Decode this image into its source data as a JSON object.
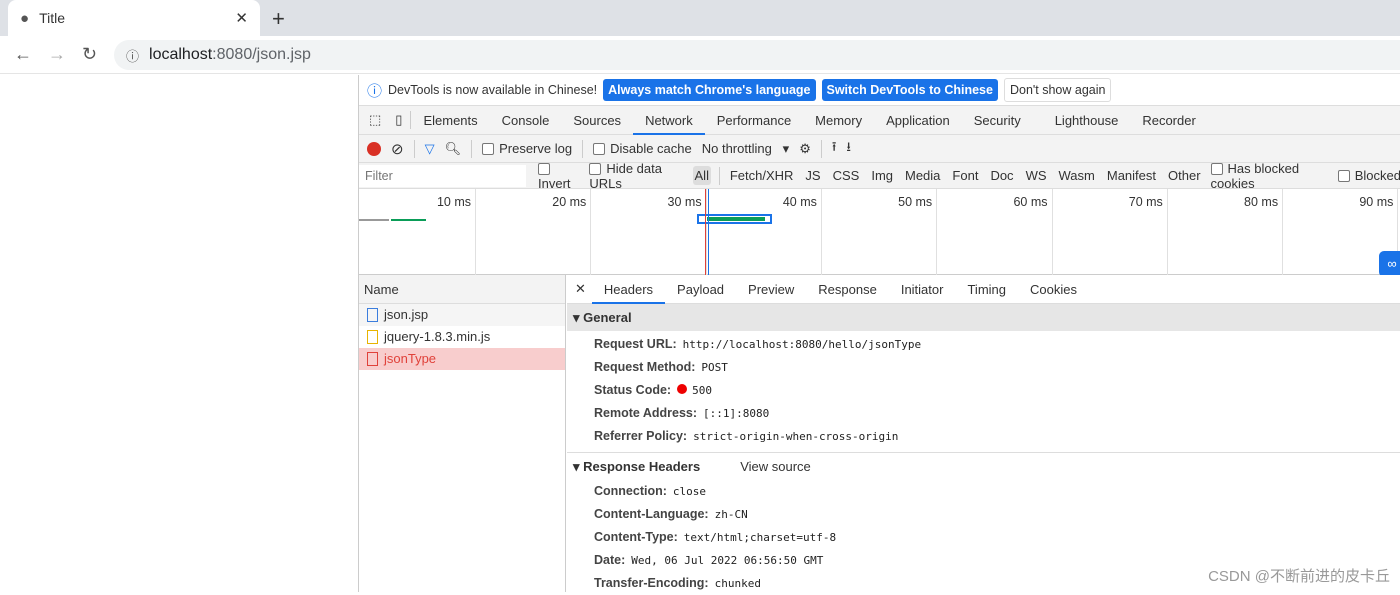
{
  "browser": {
    "tab_title": "Title",
    "url_host": "localhost",
    "url_path": ":8080/json.jsp"
  },
  "infobar": {
    "message": "DevTools is now available in Chinese!",
    "btn_match": "Always match Chrome's language",
    "btn_switch": "Switch DevTools to Chinese",
    "btn_dismiss": "Don't show again"
  },
  "tabs": [
    "Elements",
    "Console",
    "Sources",
    "Network",
    "Performance",
    "Memory",
    "Application",
    "Security",
    "Lighthouse",
    "Recorder"
  ],
  "toolbar": {
    "preserve_log": "Preserve log",
    "disable_cache": "Disable cache",
    "throttling": "No throttling"
  },
  "filterbar": {
    "placeholder": "Filter",
    "invert": "Invert",
    "hide_data_urls": "Hide data URLs",
    "types": [
      "All",
      "Fetch/XHR",
      "JS",
      "CSS",
      "Img",
      "Media",
      "Font",
      "Doc",
      "WS",
      "Wasm",
      "Manifest",
      "Other"
    ],
    "has_blocked_cookies": "Has blocked cookies",
    "blocked": "Blocked"
  },
  "overview": {
    "ticks": [
      "10 ms",
      "20 ms",
      "30 ms",
      "40 ms",
      "50 ms",
      "60 ms",
      "70 ms",
      "80 ms",
      "90 ms"
    ]
  },
  "requests": {
    "header": "Name",
    "items": [
      "json.jsp",
      "jquery-1.8.3.min.js",
      "jsonType"
    ]
  },
  "detail_tabs": [
    "Headers",
    "Payload",
    "Preview",
    "Response",
    "Initiator",
    "Timing",
    "Cookies"
  ],
  "general": {
    "title": "General",
    "rows": [
      [
        "Request URL:",
        "http://localhost:8080/hello/jsonType"
      ],
      [
        "Request Method:",
        "POST"
      ],
      [
        "Status Code:",
        "500"
      ],
      [
        "Remote Address:",
        "[::1]:8080"
      ],
      [
        "Referrer Policy:",
        "strict-origin-when-cross-origin"
      ]
    ]
  },
  "response_headers": {
    "title": "Response Headers",
    "view_source": "View source",
    "rows": [
      [
        "Connection:",
        "close"
      ],
      [
        "Content-Language:",
        "zh-CN"
      ],
      [
        "Content-Type:",
        "text/html;charset=utf-8"
      ],
      [
        "Date:",
        "Wed, 06 Jul 2022 06:56:50 GMT"
      ],
      [
        "Transfer-Encoding:",
        "chunked"
      ]
    ]
  },
  "watermark": "CSDN @不断前进的皮卡丘",
  "colors": {
    "accent": "#1a73e8",
    "error": "#e0413a",
    "record": "#d93025"
  }
}
